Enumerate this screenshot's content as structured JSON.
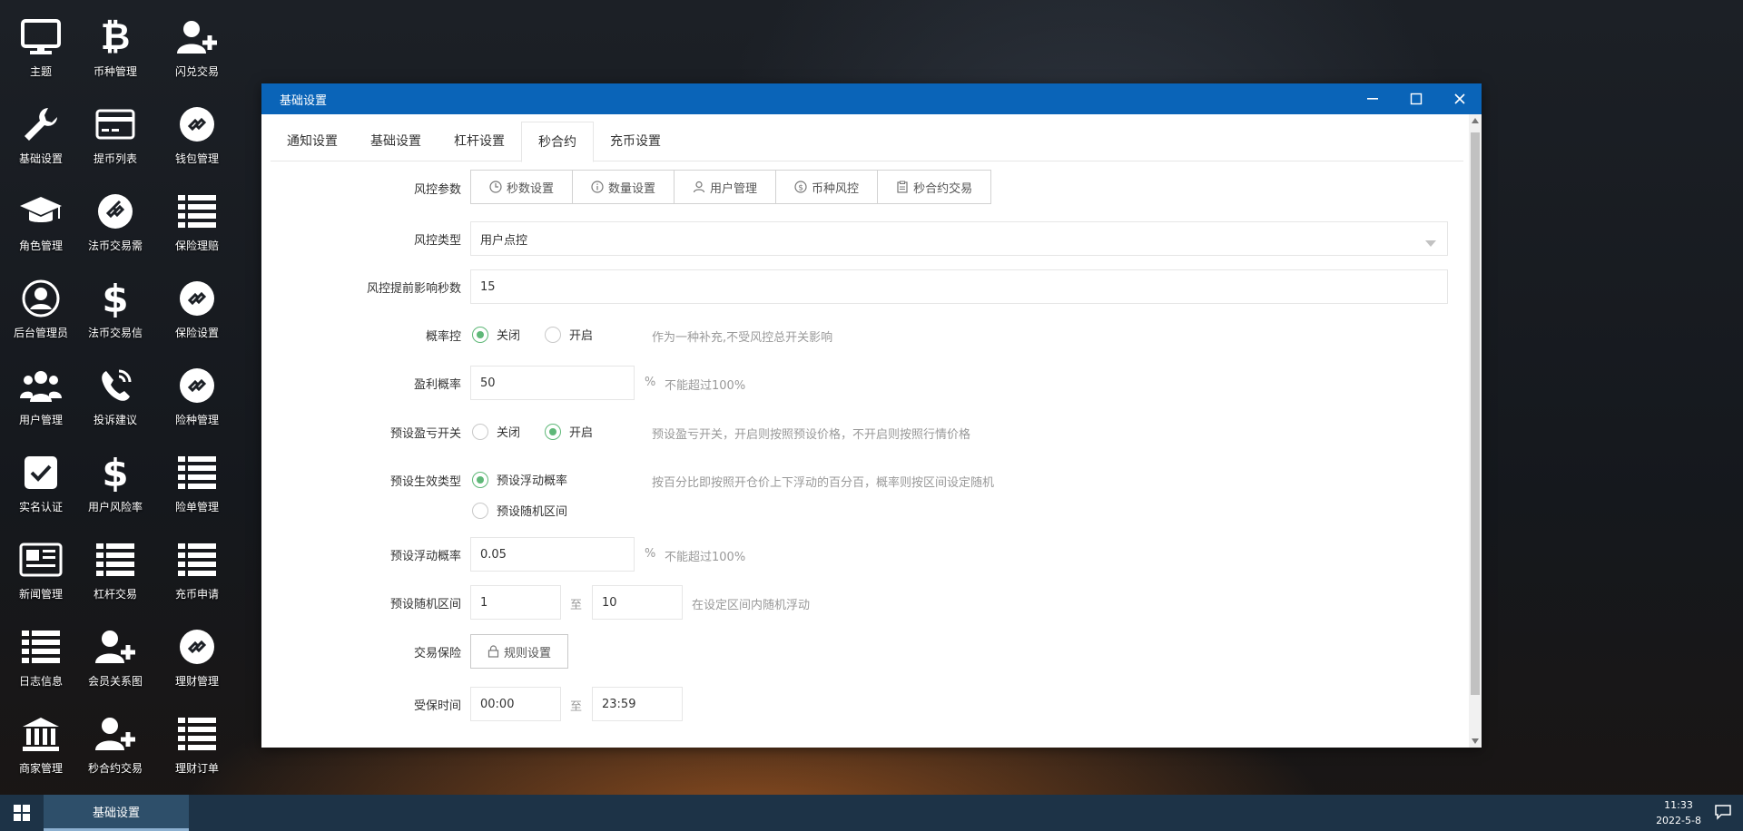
{
  "desktop": {
    "icons": [
      {
        "label": "主题"
      },
      {
        "label": "币种管理"
      },
      {
        "label": "闪兑交易"
      },
      {
        "label": "基础设置"
      },
      {
        "label": "提币列表"
      },
      {
        "label": "钱包管理"
      },
      {
        "label": "角色管理"
      },
      {
        "label": "法币交易需"
      },
      {
        "label": "保险理赔"
      },
      {
        "label": "后台管理员"
      },
      {
        "label": "法币交易信"
      },
      {
        "label": "保险设置"
      },
      {
        "label": "用户管理"
      },
      {
        "label": "投诉建议"
      },
      {
        "label": "险种管理"
      },
      {
        "label": "实名认证"
      },
      {
        "label": "用户风险率"
      },
      {
        "label": "险单管理"
      },
      {
        "label": "新闻管理"
      },
      {
        "label": "杠杆交易"
      },
      {
        "label": "充币申请"
      },
      {
        "label": "日志信息"
      },
      {
        "label": "会员关系图"
      },
      {
        "label": "理财管理"
      },
      {
        "label": "商家管理"
      },
      {
        "label": "秒合约交易"
      },
      {
        "label": "理财订单"
      }
    ]
  },
  "taskbar": {
    "active_item": "基础设置",
    "time": "11:33",
    "date": "2022-5-8"
  },
  "window": {
    "title": "基础设置",
    "tabs": [
      {
        "label": "通知设置"
      },
      {
        "label": "基础设置"
      },
      {
        "label": "杠杆设置"
      },
      {
        "label": "秒合约"
      },
      {
        "label": "充币设置"
      }
    ],
    "form": {
      "risk_params": {
        "label": "风控参数",
        "buttons": [
          {
            "label": "秒数设置"
          },
          {
            "label": "数量设置"
          },
          {
            "label": "用户管理"
          },
          {
            "label": "币种风控"
          },
          {
            "label": "秒合约交易"
          }
        ]
      },
      "risk_type": {
        "label": "风控类型",
        "value": "用户点控"
      },
      "risk_seconds": {
        "label": "风控提前影响秒数",
        "value": "15"
      },
      "prob_control": {
        "label": "概率控",
        "off": "关闭",
        "on": "开启",
        "hint": "作为一种补充,不受风控总开关影响"
      },
      "profit_prob": {
        "label": "盈利概率",
        "value": "50",
        "unit": "%",
        "hint": "不能超过100%"
      },
      "preset_switch": {
        "label": "预设盈亏开关",
        "off": "关闭",
        "on": "开启",
        "hint": "预设盈亏开关，开启则按照预设价格，不开启则按照行情价格"
      },
      "preset_type": {
        "label": "预设生效类型",
        "opt1": "预设浮动概率",
        "opt2": "预设随机区间",
        "hint": "按百分比即按照开仓价上下浮动的百分百，概率则按区间设定随机"
      },
      "float_prob": {
        "label": "预设浮动概率",
        "value": "0.05",
        "unit": "%",
        "hint": "不能超过100%"
      },
      "random_range": {
        "label": "预设随机区间",
        "from": "1",
        "to_label": "至",
        "to": "10",
        "hint": "在设定区间内随机浮动"
      },
      "insurance": {
        "label": "交易保险",
        "button": "规则设置"
      },
      "protect_time": {
        "label": "受保时间",
        "from": "00:00",
        "to_label": "至",
        "to": "23:59"
      }
    }
  }
}
